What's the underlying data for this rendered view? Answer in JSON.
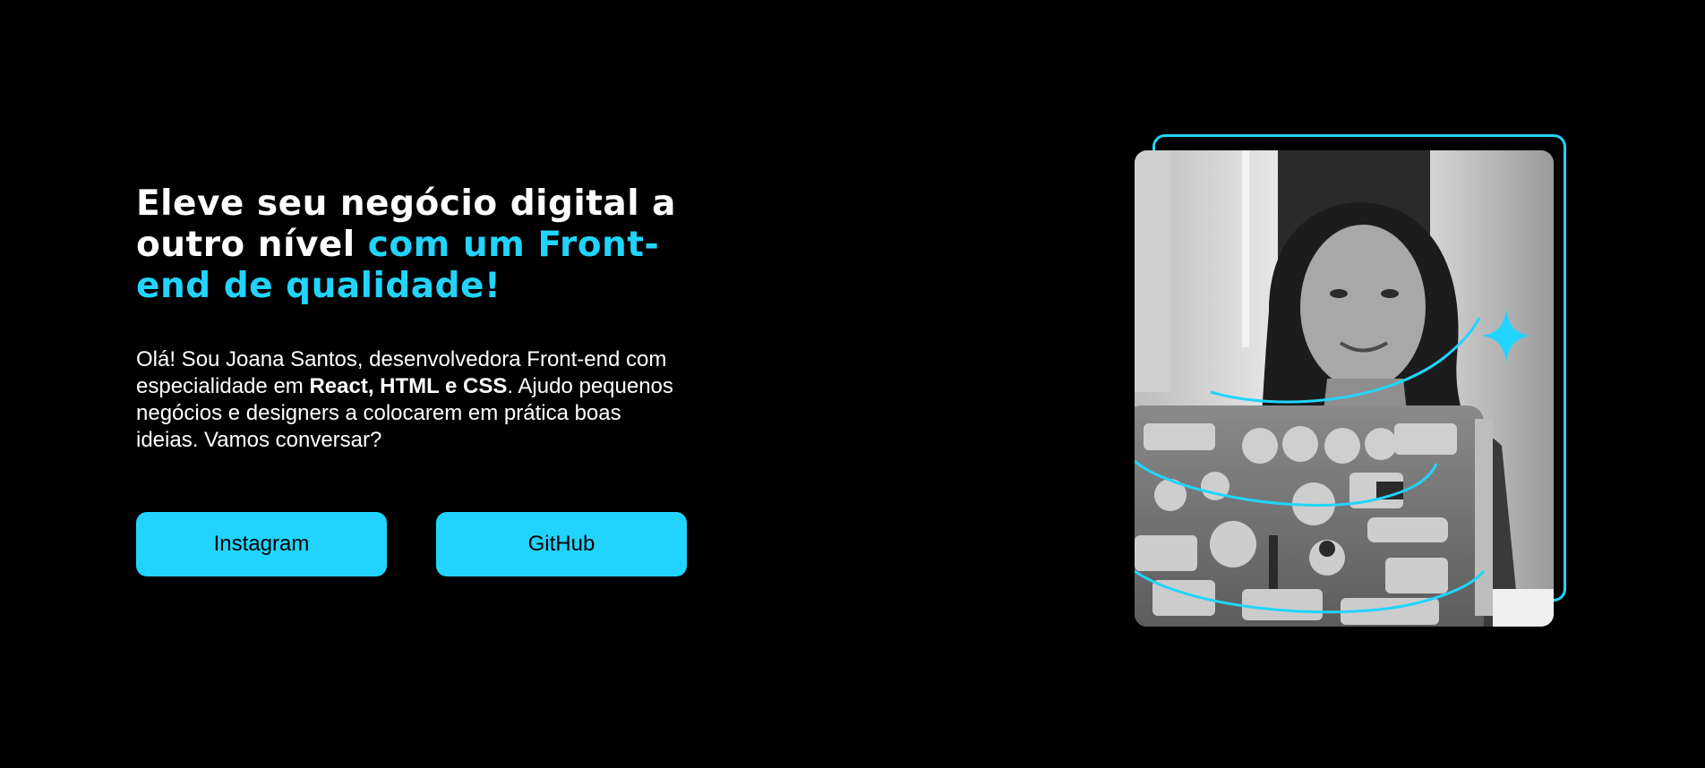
{
  "hero": {
    "headline": {
      "white_part": "Eleve seu negócio digital a outro nível ",
      "accent_part": "com um Front-end de qualidade!"
    },
    "intro": {
      "part1": "Olá! Sou Joana Santos, desenvolvedora Front-end com especialidade em ",
      "bold": "React, HTML e CSS",
      "part2": ". Ajudo pequenos negócios e designers a colocarem em prática boas ideias. Vamos conversar?"
    },
    "buttons": {
      "instagram": "Instagram",
      "github": "GitHub"
    }
  },
  "photo": {
    "description_icon": "portrait-photo"
  },
  "colors": {
    "background": "#000000",
    "accent": "#22d4fd",
    "text": "#ffffff"
  }
}
